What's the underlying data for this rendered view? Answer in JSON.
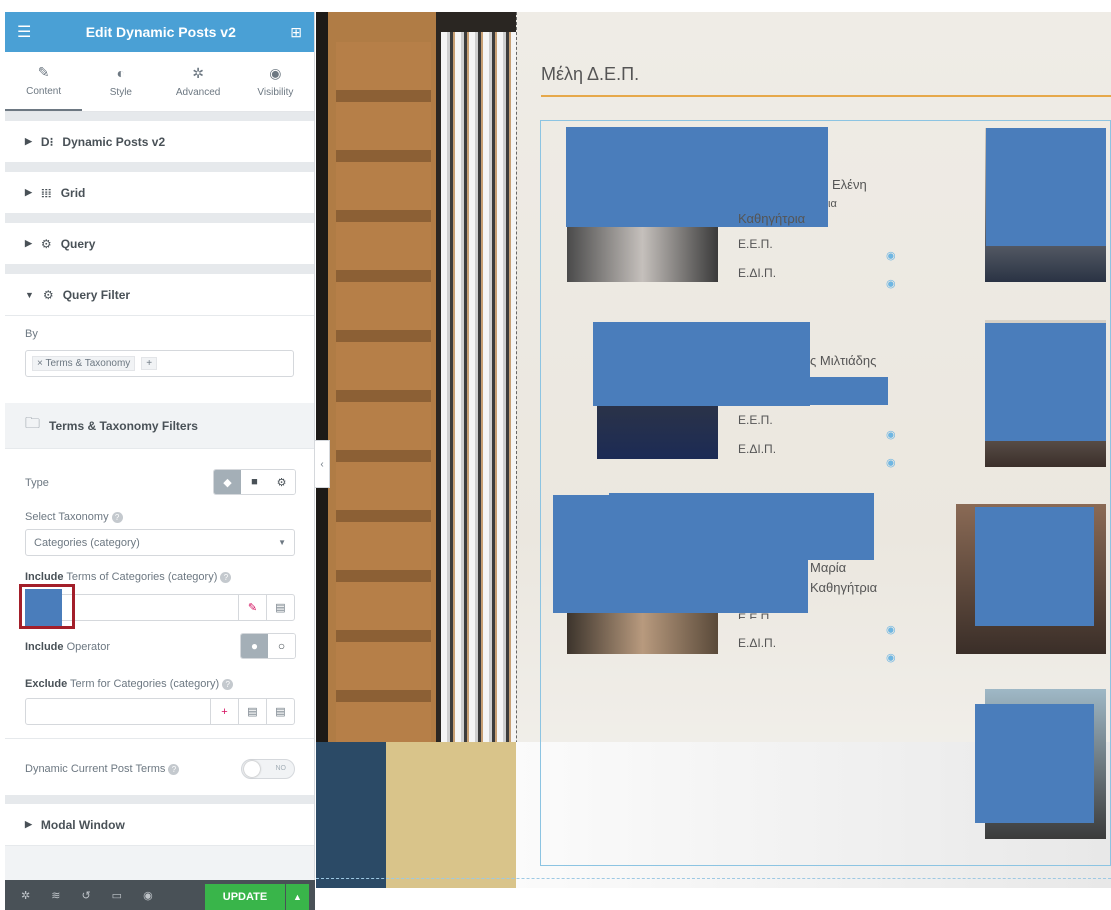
{
  "editor": {
    "title": "Edit Dynamic Posts v2",
    "tabs": [
      {
        "label": "Content",
        "icon": "pencil-icon"
      },
      {
        "label": "Style",
        "icon": "contrast-icon"
      },
      {
        "label": "Advanced",
        "icon": "gear-icon"
      },
      {
        "label": "Visibility",
        "icon": "eye-icon"
      }
    ],
    "sections": {
      "dynamic_posts": "Dynamic Posts v2",
      "grid": "Grid",
      "query": "Query",
      "query_filter": "Query Filter",
      "modal_window": "Modal Window"
    },
    "by_label": "By",
    "by_tag": "Terms & Taxonomy",
    "terms_filters": "Terms & Taxonomy Filters",
    "type_label": "Type",
    "select_taxonomy_label": "Select Taxonomy",
    "select_taxonomy_value": "Categories (category)",
    "include_label_bold": "Include",
    "include_label_rest": "Terms of Categories (category)",
    "include_operator_bold": "Include",
    "include_operator_rest": "Operator",
    "exclude_label_bold": "Exclude",
    "exclude_label_rest": "Term for Categories (category)",
    "dynamic_current_label": "Dynamic Current Post Terms",
    "toggle_value": "NO",
    "update_label": "UPDATE"
  },
  "preview": {
    "heading": "Μέλη Δ.Ε.Π.",
    "cards": [
      {
        "name_fragment": "Ελένη",
        "rank_fragment": "Καθηγήτρια",
        "role_fragment": "ια",
        "field1": "Ε.Ε.Π.",
        "field2": "Ε.ΔΙ.Π."
      },
      {
        "name_fragment": "ς Μιλτιάδης",
        "field1": "Ε.Ε.Π.",
        "field2": "Ε.ΔΙ.Π."
      },
      {
        "name_fragment": "Μαρία",
        "rank_fragment": "Καθηγήτρια",
        "field1": "Ε.Ε.Π.",
        "field2": "Ε.ΔΙ.Π."
      }
    ]
  },
  "colors": {
    "header": "#4aa0d5",
    "update": "#39b54a",
    "redaction": "#4a7dbb",
    "accent_line": "#e6a84a"
  }
}
